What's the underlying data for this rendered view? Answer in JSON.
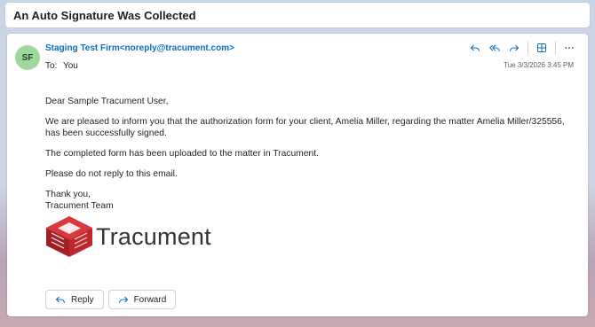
{
  "subject": "An Auto Signature Was Collected",
  "sender": {
    "initials": "SF",
    "display": "Staging Test Firm<noreply@tracument.com>",
    "avatar_color": "#9fd89f"
  },
  "recipient": {
    "label": "To:",
    "value": "You"
  },
  "date": "Tue 3/3/2026 3:45 PM",
  "toolbar": {
    "reply_icon": "reply-icon",
    "reply_all_icon": "reply-all-icon",
    "forward_icon": "forward-icon",
    "apps_icon": "apps-grid-icon",
    "more_icon": "more-icon"
  },
  "body": {
    "greeting": "Dear Sample Tracument User,",
    "para1": "We are pleased to inform you that the authorization form for your client, Amelia Miller, regarding the matter Amelia Miller/325556, has been successfully signed.",
    "para2": "The completed form has been uploaded to the matter in Tracument.",
    "para3": "Please do not reply to this email.",
    "closing": "Thank you,",
    "signature": "Tracument Team"
  },
  "logo": {
    "text": "Tracument",
    "color": "#c0272d"
  },
  "buttons": {
    "reply": "Reply",
    "forward": "Forward"
  },
  "accent_color": "#0f6cbd"
}
